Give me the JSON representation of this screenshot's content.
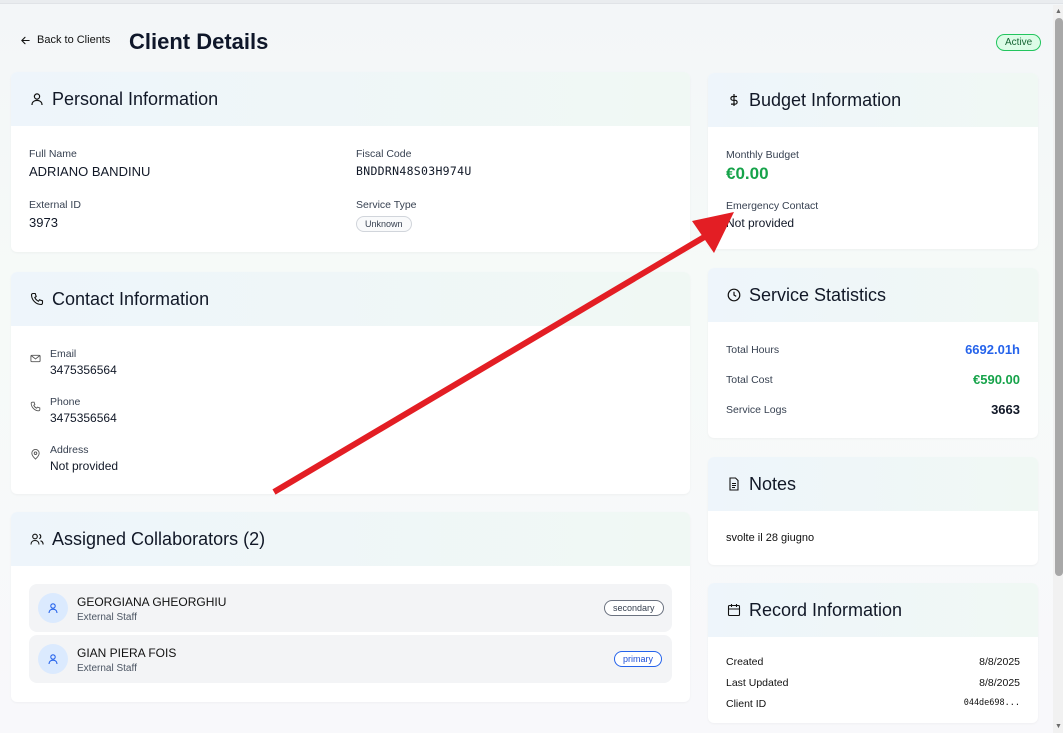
{
  "header": {
    "back_label": "Back to Clients",
    "title": "Client Details",
    "status": "Active"
  },
  "personal": {
    "title": "Personal Information",
    "full_name_label": "Full Name",
    "full_name": "ADRIANO BANDINU",
    "fiscal_code_label": "Fiscal Code",
    "fiscal_code": "BNDDRN48S03H974U",
    "external_id_label": "External ID",
    "external_id": "3973",
    "service_type_label": "Service Type",
    "service_type": "Unknown"
  },
  "contact": {
    "title": "Contact Information",
    "email_label": "Email",
    "email": "3475356564",
    "phone_label": "Phone",
    "phone": "3475356564",
    "address_label": "Address",
    "address": "Not provided"
  },
  "collaborators": {
    "title": "Assigned Collaborators (2)",
    "items": [
      {
        "name": "GEORGIANA GHEORGHIU",
        "role": "External Staff",
        "badge": "secondary"
      },
      {
        "name": "GIAN PIERA FOIS",
        "role": "External Staff",
        "badge": "primary"
      }
    ]
  },
  "budget": {
    "title": "Budget Information",
    "monthly_label": "Monthly Budget",
    "monthly": "€0.00",
    "emergency_label": "Emergency Contact",
    "emergency": "Not provided"
  },
  "stats": {
    "title": "Service Statistics",
    "hours_label": "Total Hours",
    "hours": "6692.01h",
    "cost_label": "Total Cost",
    "cost": "€590.00",
    "logs_label": "Service Logs",
    "logs": "3663"
  },
  "notes": {
    "title": "Notes",
    "text": "svolte il 28 giugno"
  },
  "record": {
    "title": "Record Information",
    "created_label": "Created",
    "created": "8/8/2025",
    "updated_label": "Last Updated",
    "updated": "8/8/2025",
    "client_id_label": "Client ID",
    "client_id": "044de698..."
  },
  "colors": {
    "accent_green": "#16a34a",
    "accent_blue": "#2563eb",
    "annotation_arrow": "#e31e24"
  },
  "icons": [
    "arrow-left-icon",
    "user-icon",
    "phone-icon",
    "mail-icon",
    "map-pin-icon",
    "users-icon",
    "dollar-icon",
    "clock-icon",
    "file-text-icon",
    "calendar-icon"
  ]
}
